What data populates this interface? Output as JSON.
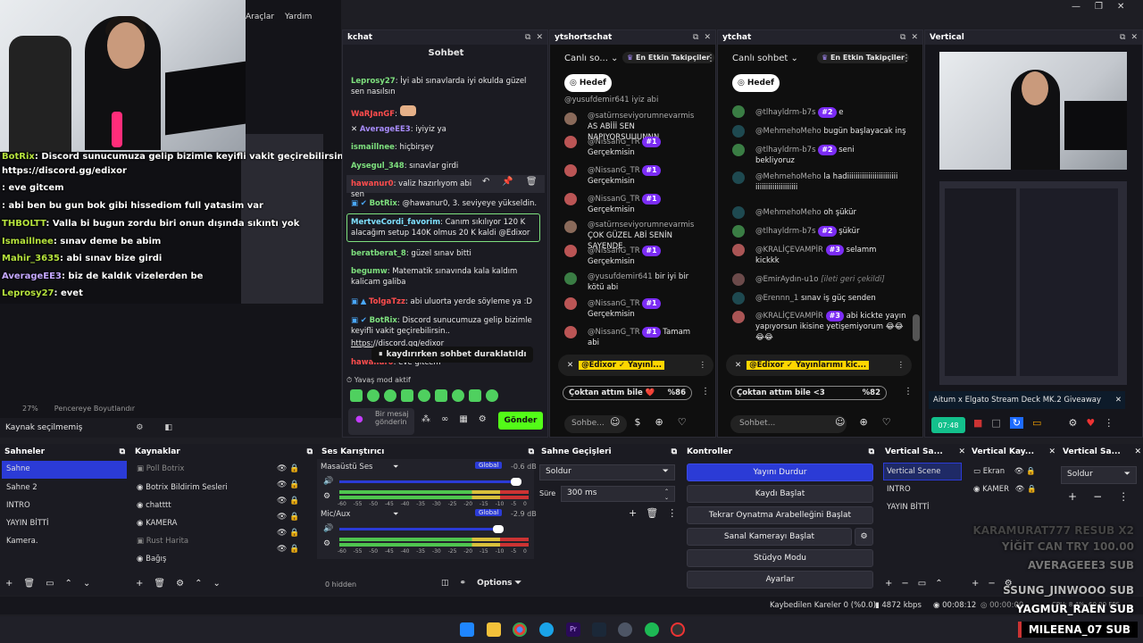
{
  "menu": [
    "Araçlar",
    "Yardım"
  ],
  "overlay_chat": [
    {
      "name": "BotRix",
      "text": ": Discord sunucumuza gelip bizimle keyifli vakit geçirebilirsin.."
    },
    {
      "name": "",
      "text": "https://discord.gg/edixor"
    },
    {
      "name": "",
      "text": ": eve gitcem"
    },
    {
      "name": "",
      "text": ": abi ben bu gun bok gibi hissediom full yatasim var"
    },
    {
      "name": "THBOLTT",
      "text": ": Valla bi bugun zordu biri onun dışında sıkıntı yok"
    },
    {
      "name": "Ismaillnee",
      "text": ": sınav deme be abim"
    },
    {
      "name": "Mahir_3635",
      "text": ": abi sınav bize girdi"
    },
    {
      "name": "AverageEE3",
      "text": ": biz de kaldık vizelerden be"
    },
    {
      "name": "Leprosy27",
      "text": ": evet"
    }
  ],
  "preview_footer": {
    "zoom": "27%",
    "label": "Pencereye Boyutlandır"
  },
  "source_status": "Kaynak seçilmemiş",
  "kchat": {
    "tab": "kchat",
    "title": "Sohbet",
    "messages": [
      {
        "name": "Leprosy27",
        "text": ": İyi abi sınavlarda iyi okulda güzel sen nasılsın",
        "color": "#7ee07e"
      },
      {
        "name": "WaRJanGF",
        "text": ":",
        "color": "#ff4d4d"
      },
      {
        "name": "AverageEE3",
        "text": ": iyiyiz ya",
        "color": "#a78bfa"
      },
      {
        "name": "ismaillnee",
        "text": ": hiçbirşey",
        "color": "#7ee07e"
      },
      {
        "name": "Aysegul_348",
        "text": ": sınavlar girdi",
        "color": "#7ee07e"
      },
      {
        "name": "hawanur0",
        "text": ": valiz hazırlıyom abi sen",
        "color": "#ff4d4d"
      },
      {
        "name": "BotRix",
        "text": ": @hawanur0, 3. seviyeye yükseldin.",
        "color": "#7ee07e"
      },
      {
        "name": "MertveCordi_favorim",
        "text": ": Canım sıkılıyor 120 K alacağım setup 140K olmus 20 K kaldi @Edixor",
        "color": "#7ee0ff"
      },
      {
        "name": "beratberat_8",
        "text": ": güzel sınav bitti",
        "color": "#7ee07e"
      },
      {
        "name": "begumw",
        "text": ": Matematik sınavında kala kaldım kalicam galiba",
        "color": "#7ee07e"
      },
      {
        "name": "TolgaTzz",
        "text": ": abi uluorta yerde söyleme ya :D",
        "color": "#ff4d4d"
      },
      {
        "name": "BotRix",
        "text": ": Discord sunucumuza gelip bizimle keyifli vakit geçirebilirsin..",
        "color": "#7ee07e"
      },
      {
        "name": "",
        "text": "https://discord.gg/edixor",
        "color": "#ccc"
      },
      {
        "name": "hawanur0",
        "text": ": eve gitcem",
        "color": "#ff4d4d"
      }
    ],
    "paused": "kaydırırken sohbet duraklatıldı",
    "slow_mode": "Yavaş mod aktif",
    "input_placeholder": "Bir mesaj gönderin",
    "send": "Gönder"
  },
  "ytshortschat": {
    "tab": "ytshortschat",
    "mode": "Canlı so...",
    "top_fans": "En Etkin Takipçiler",
    "goal": "Hedef",
    "messages": [
      {
        "name": "@yusufdemir641",
        "text": "iyiz abi",
        "badge": ""
      },
      {
        "name": "@satürnseviyorumnevarmis",
        "text": "AS ABİİİ SEN NAPIYORSUUUNNN",
        "badge": ""
      },
      {
        "name": "@NissanG_TR",
        "text": "Gerçekmisin",
        "badge": "#1"
      },
      {
        "name": "@NissanG_TR",
        "text": "Gerçekmisin",
        "badge": "#1"
      },
      {
        "name": "@NissanG_TR",
        "text": "Gerçekmisin",
        "badge": "#1"
      },
      {
        "name": "@satürnseviyorumnevarmis",
        "text": "ÇOK GÜZEL ABİ SENİN SAYENDE",
        "badge": ""
      },
      {
        "name": "@NissanG_TR",
        "text": "Gerçekmisin",
        "badge": "#1"
      },
      {
        "name": "@yusufdemir641",
        "text": "bir iyi bir kötü abi",
        "badge": ""
      },
      {
        "name": "@NissanG_TR",
        "text": "Gerçekmisin",
        "badge": "#1"
      },
      {
        "name": "@NissanG_TR",
        "text": "Tamam abi",
        "badge": "#1"
      }
    ],
    "pinned": "@Edixor ✓ Yayınl...",
    "poll": "Çoktan attım bile ❤️",
    "poll_pct": "%86",
    "input": "Sohbe..."
  },
  "ytchat": {
    "tab": "ytchat",
    "mode": "Canlı sohbet",
    "top_fans": "En Etkin Takipçiler",
    "goal": "Hedef",
    "messages": [
      {
        "name": "@tlhayldrm-b7s",
        "text": "e",
        "badge": "#2"
      },
      {
        "name": "@MehmehoMeho",
        "text": "bugün başlayacak inş",
        "badge": ""
      },
      {
        "name": "@tlhayldrm-b7s",
        "text": "seni bekliyoruz",
        "badge": "#2"
      },
      {
        "name": "@MehmehoMeho",
        "text": "la hadiiiiiiiiiiiiiiiiiiiiiiiiiiiiiiiiiiiiiiiiiiii",
        "badge": ""
      },
      {
        "name": "@MehmehoMeho",
        "text": "oh şükür",
        "badge": ""
      },
      {
        "name": "@tlhayldrm-b7s",
        "text": "şükür",
        "badge": "#2"
      },
      {
        "name": "@KRALİÇEVAMPİR",
        "text": "selamm kickkk",
        "badge": "#3"
      },
      {
        "name": "@EmirAydın-u1o",
        "text": "[ileti geri çekildi]",
        "badge": ""
      },
      {
        "name": "@Erennn_1",
        "text": "sınav iş güç senden",
        "badge": ""
      },
      {
        "name": "@KRALİÇEVAMPİR",
        "text": "abi kickte yayın yapıyorsun ikisine yetişemiyorum 😂😂😂😂",
        "badge": "#3"
      }
    ],
    "pinned": "@Edixor ✓ Yayınlarımı kic...",
    "poll": "Çoktan attım bile <3",
    "poll_pct": "%82",
    "input": "Sohbet..."
  },
  "vertical": {
    "tab": "Vertical",
    "banner": "Aitum x Elgato Stream Deck MK.2 Giveaway",
    "timer": "07:48"
  },
  "docks": {
    "scenes": {
      "title": "Sahneler",
      "items": [
        "Sahne",
        "Sahne 2",
        "INTRO",
        "YAYIN BİTTİ",
        "Kamera."
      ]
    },
    "sources": {
      "title": "Kaynaklar",
      "items": [
        "Poll Botrix",
        "Botrix Bildirim Sesleri",
        "chatttt",
        "KAMERA",
        "Rust Harita",
        "Bağış"
      ]
    },
    "mixer": {
      "title": "Ses Karıştırıcı",
      "channels": [
        {
          "name": "Masaüstü Ses",
          "tag": "Global",
          "db": "-0.6 dB"
        },
        {
          "name": "Mic/Aux",
          "tag": "Global",
          "db": "-2.9 dB"
        }
      ],
      "ticks": [
        "-60",
        "-55",
        "-50",
        "-45",
        "-40",
        "-35",
        "-30",
        "-25",
        "-20",
        "-15",
        "-10",
        "-5",
        "0"
      ],
      "hidden": "0 hidden",
      "options": "Options"
    },
    "transitions": {
      "title": "Sahne Geçişleri",
      "type": "Soldur",
      "duration_label": "Süre",
      "duration": "300 ms"
    },
    "controls": {
      "title": "Kontroller",
      "buttons": [
        "Yayını Durdur",
        "Kaydı Başlat",
        "Tekrar Oynatma Arabelleğini Başlat",
        "Sanal Kamerayı Başlat",
        "Stüdyo Modu",
        "Ayarlar"
      ]
    },
    "vscenes": {
      "title": "Vertical Sa...",
      "items": [
        "Vertical Scene",
        "INTRO",
        "YAYIN BİTTİ"
      ]
    },
    "vsources": {
      "title": "Vertical Kay...",
      "items": [
        "Ekran",
        "KAMER"
      ]
    },
    "vtrans": {
      "title": "Vertical Sa...",
      "type": "Soldur"
    }
  },
  "status": {
    "dropped": "Kaybedilen Kareler 0 (%0.0)",
    "kbps": "4872 kbps",
    "time": "00:08:12",
    "rec": "00:00:00",
    "cpu": "CPU: 8.4%, 60.00 FPS"
  },
  "alerts": [
    "KARAMURAT777  RESUB X2",
    "YİĞİT CAN  TRY 100.00",
    "AVERAGEEE3  SUB",
    "SSUNG_JINWOOO  SUB",
    "YAGMUR_RAEN  SUB",
    "MILEENA_07  SUB"
  ]
}
